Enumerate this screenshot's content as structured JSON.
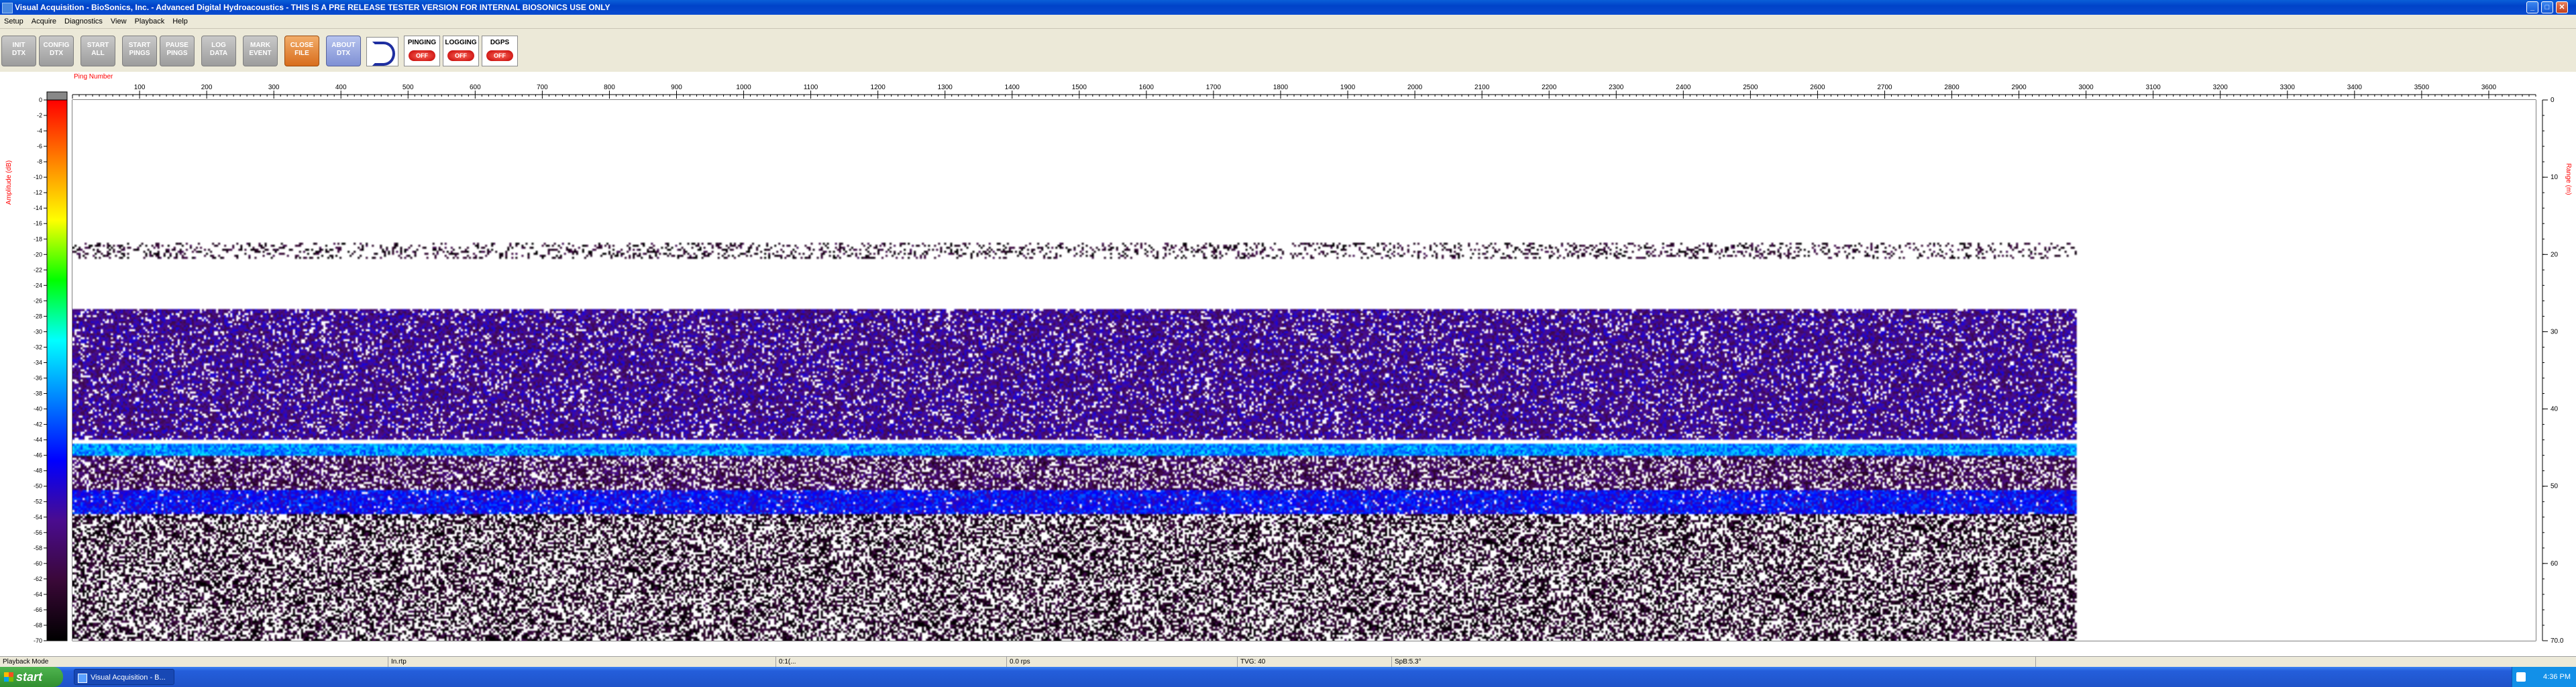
{
  "window": {
    "title": "Visual Acquisition  -  BioSonics, Inc.  -  Advanced Digital Hydroacoustics  -  THIS IS A PRE RELEASE TESTER VERSION FOR INTERNAL BIOSONICS USE ONLY",
    "minimize_glyph": "_",
    "maximize_glyph": "□",
    "close_glyph": "✕"
  },
  "menu": [
    "Setup",
    "Acquire",
    "Diagnostics",
    "View",
    "Playback",
    "Help"
  ],
  "toolbar": {
    "buttons": [
      {
        "label": "INIT\nDTX",
        "style": "gray"
      },
      {
        "label": "CONFIG\nDTX",
        "style": "gray"
      },
      {
        "label": "START\nALL",
        "style": "gray"
      },
      {
        "label": "START\nPINGS",
        "style": "gray"
      },
      {
        "label": "PAUSE\nPINGS",
        "style": "gray"
      },
      {
        "label": "LOG\nDATA",
        "style": "gray"
      },
      {
        "label": "MARK\nEVENT",
        "style": "gray"
      },
      {
        "label": "CLOSE\nFILE",
        "style": "close"
      },
      {
        "label": "ABOUT\nDTX",
        "style": "about"
      }
    ],
    "logo_icon": "biosonics-logo-icon",
    "indicators": [
      {
        "label": "PINGING",
        "state": "OFF"
      },
      {
        "label": "LOGGING",
        "state": "OFF"
      },
      {
        "label": "DGPS",
        "state": "OFF"
      }
    ]
  },
  "chart_data": {
    "type": "heatmap",
    "title": "",
    "xlabel": "Ping Number",
    "ylabel_left": "Amplitude (dB)",
    "ylabel_right": "Range (m)",
    "x_ticks": [
      100,
      200,
      300,
      400,
      500,
      600,
      700,
      800,
      900,
      1000,
      1100,
      1200,
      1300,
      1400,
      1500,
      1600,
      1700,
      1800,
      1900,
      2000,
      2100,
      2200,
      2300,
      2400,
      2500,
      2600,
      2700,
      2800,
      2900,
      3000,
      3100,
      3200,
      3300,
      3400,
      3500,
      3600
    ],
    "xlim": [
      0,
      3670
    ],
    "range_ticks": [
      0,
      10,
      20,
      30,
      40,
      50,
      60,
      70
    ],
    "range_tick_labels": [
      "0",
      "10",
      "20",
      "30",
      "40",
      "50",
      "60",
      "70.0"
    ],
    "ylim_range": [
      0,
      70
    ],
    "colorbar_ticks": [
      0,
      -2,
      -4,
      -6,
      -8,
      -10,
      -12,
      -14,
      -16,
      -18,
      -20,
      -22,
      -24,
      -26,
      -28,
      -30,
      -32,
      -34,
      -36,
      -38,
      -40,
      -42,
      -44,
      -46,
      -48,
      -50,
      -52,
      -54,
      -56,
      -58,
      -60,
      -62,
      -64,
      -66,
      -68,
      -70
    ],
    "colorbar_range": [
      0,
      -70
    ],
    "data_ping_extent": [
      0,
      2985
    ],
    "layers": [
      {
        "range_start": 18.5,
        "range_end": 20.5,
        "amplitude_db": -66,
        "density": 0.25
      },
      {
        "range_start": 27,
        "range_end": 44,
        "amplitude_db": -55,
        "density": 0.85
      },
      {
        "range_start": 44.5,
        "range_end": 46,
        "amplitude_db": -38,
        "density": 1.0
      },
      {
        "range_start": 46,
        "range_end": 50.5,
        "amplitude_db": -60,
        "density": 0.7
      },
      {
        "range_start": 50.5,
        "range_end": 53.5,
        "amplitude_db": -47,
        "density": 0.95
      },
      {
        "range_start": 53.5,
        "range_end": 70,
        "amplitude_db": -66,
        "density": 0.55
      }
    ],
    "colors": {
      "background": "#ffffff",
      "scale": [
        "#ff0000",
        "#ff8000",
        "#ffff00",
        "#00ff00",
        "#00ffff",
        "#0080ff",
        "#0000ff",
        "#4a0c8f",
        "#3a0838",
        "#000000"
      ],
      "axis_label": "#ff0000"
    }
  },
  "status_bar": [
    "Playback Mode",
    "In.rtp",
    "0:1(...",
    "0.0 rps",
    "TVG: 40",
    "SpB:5.3°"
  ],
  "taskbar": {
    "start_label": "start",
    "task_label": "Visual Acquisition - B...",
    "clock": "4:36 PM"
  }
}
